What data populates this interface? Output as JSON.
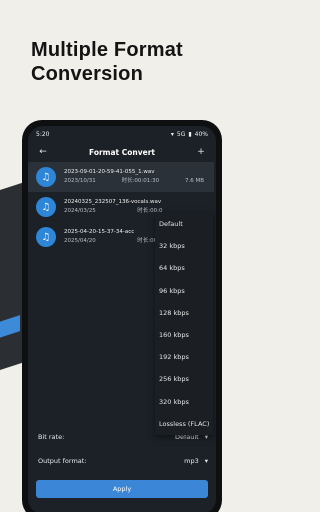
{
  "promo": {
    "line1": "Multiple Format",
    "line2": "Conversion"
  },
  "status_bar": {
    "time": "5:20",
    "battery": "40%",
    "signal": "5G"
  },
  "app_bar": {
    "back_icon": "arrow-left-icon",
    "title": "Format Convert",
    "add_icon": "plus-icon"
  },
  "files": [
    {
      "name": "2023-09-01-20-59-41-055_1.wav",
      "date": "2023/10/31",
      "duration": "时长:00:01:30",
      "size": "7.6 MB"
    },
    {
      "name": "20240325_232507_136-vocals.wav",
      "date": "2024/03/25",
      "duration": "时长:00:0",
      "size": ""
    },
    {
      "name": "2025-04-20-15-37-34-acc",
      "date": "2025/04/20",
      "duration": "时长:00:0",
      "size": ""
    }
  ],
  "dropdown": {
    "options": [
      "Default",
      "32 kbps",
      "64 kbps",
      "96 kbps",
      "128 kbps",
      "160 kbps",
      "192 kbps",
      "256 kbps",
      "320 kbps",
      "Lossless (FLAC)"
    ]
  },
  "settings": {
    "bitrate_label": "Bit rate:",
    "bitrate_value": "Default",
    "format_label": "Output format:",
    "format_value": "mp3"
  },
  "apply_label": "Apply"
}
